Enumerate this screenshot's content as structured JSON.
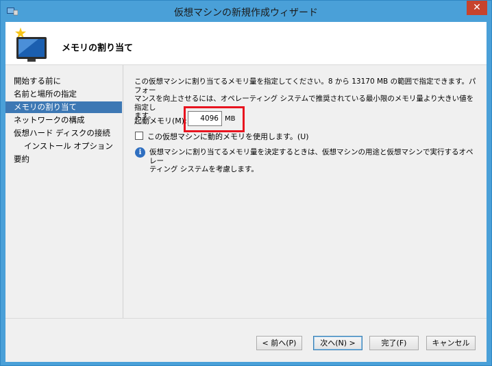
{
  "window": {
    "title": "仮想マシンの新規作成ウィザード",
    "close_label": "✕"
  },
  "header": {
    "title": "メモリの割り当て"
  },
  "nav": {
    "items": [
      {
        "label": "開始する前に"
      },
      {
        "label": "名前と場所の指定"
      },
      {
        "label": "メモリの割り当て"
      },
      {
        "label": "ネットワークの構成"
      },
      {
        "label": "仮想ハード ディスクの接続"
      },
      {
        "label": "インストール オプション"
      },
      {
        "label": "要約"
      }
    ],
    "active_index": 2
  },
  "content": {
    "description_line1": "この仮想マシンに割り当てるメモリ量を指定してください。8 から 13170 MB の範囲で指定できます。パフォー",
    "description_line2": "マンスを向上させるには、オペレーティング システムで推奨されている最小限のメモリ量より大きい値を指定し",
    "description_line3": "ます。",
    "startup_memory_label": "起動メモリ(M):",
    "startup_memory_value": "4096",
    "memory_unit": "MB",
    "dynamic_memory_label": "この仮想マシンに動的メモリを使用します。(U)",
    "dynamic_memory_checked": false,
    "info_line1": "仮想マシンに割り当てるメモリ量を決定するときは、仮想マシンの用途と仮想マシンで実行するオペレー",
    "info_line2": "ティング システムを考慮します。"
  },
  "buttons": {
    "back": "< 前へ(P)",
    "next": "次へ(N) >",
    "finish": "完了(F)",
    "cancel": "キャンセル"
  },
  "colors": {
    "title_bar": "#4aa0d8",
    "close_button": "#c7432d",
    "nav_active": "#3d78b4",
    "highlight_box": "#e8141f"
  }
}
